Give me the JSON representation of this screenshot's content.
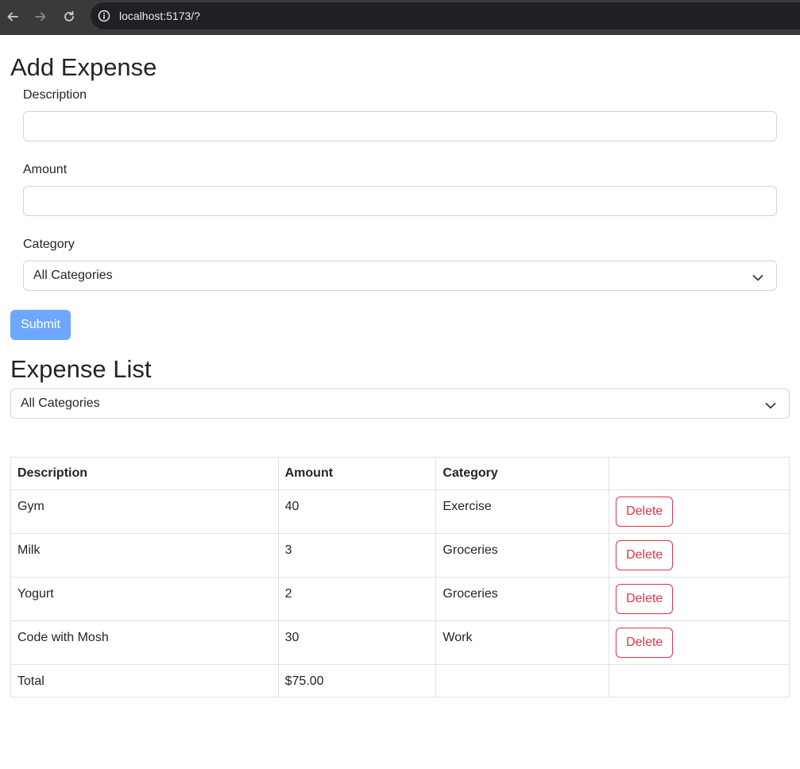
{
  "browser": {
    "url": "localhost:5173/?",
    "back_icon": "arrow-left-icon",
    "forward_icon": "arrow-right-icon",
    "reload_icon": "reload-icon",
    "info_icon": "info-icon"
  },
  "form": {
    "title": "Add Expense",
    "description_label": "Description",
    "description_value": "",
    "amount_label": "Amount",
    "amount_value": "",
    "category_label": "Category",
    "category_selected": "All Categories",
    "submit_label": "Submit"
  },
  "list": {
    "title": "Expense List",
    "filter_selected": "All Categories",
    "headers": {
      "description": "Description",
      "amount": "Amount",
      "category": "Category",
      "actions": ""
    },
    "rows": [
      {
        "description": "Gym",
        "amount": "40",
        "category": "Exercise",
        "action": "Delete"
      },
      {
        "description": "Milk",
        "amount": "3",
        "category": "Groceries",
        "action": "Delete"
      },
      {
        "description": "Yogurt",
        "amount": "2",
        "category": "Groceries",
        "action": "Delete"
      },
      {
        "description": "Code with Mosh",
        "amount": "30",
        "category": "Work",
        "action": "Delete"
      }
    ],
    "total_label": "Total",
    "total_value": "$75.00"
  },
  "colors": {
    "submit_bg": "#6ea8fe",
    "delete": "#dc3545",
    "border": "#dee2e6"
  }
}
